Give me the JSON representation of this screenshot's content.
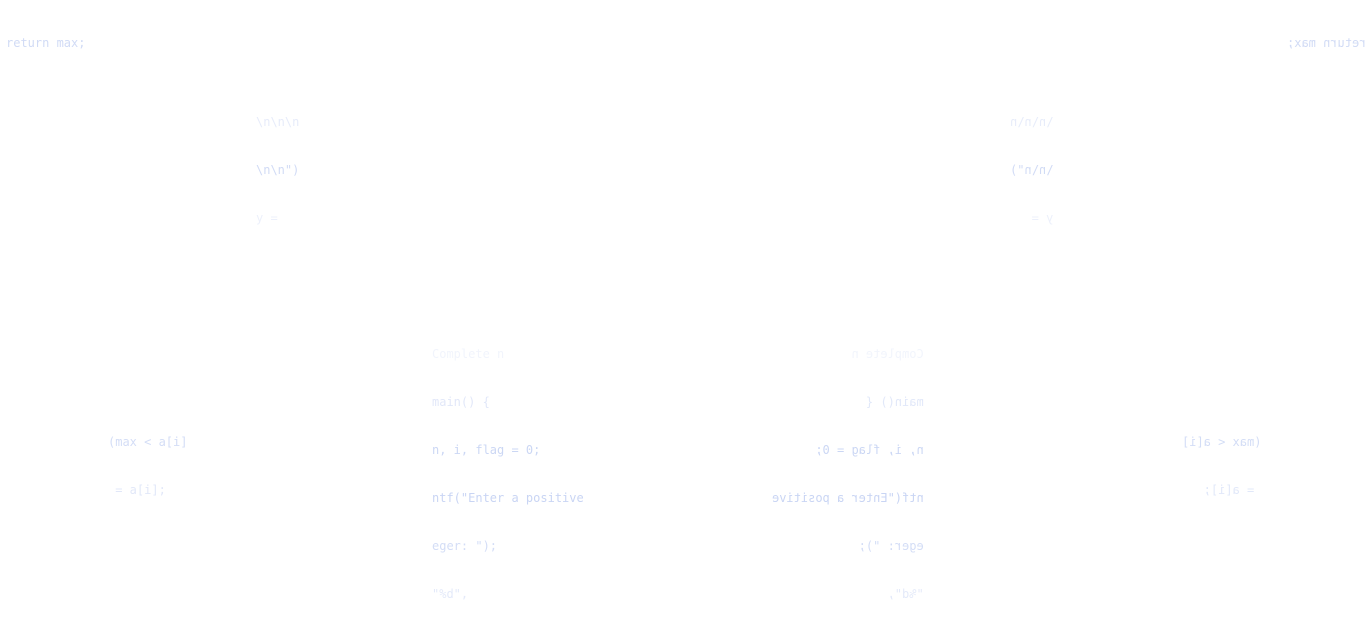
{
  "fragments": {
    "top_left": [
      "return max;"
    ],
    "top_right": [
      "return max;"
    ],
    "upper_left": [
      "\\n\\n\\n",
      "\\n\\n\")",
      "y = "
    ],
    "upper_right": [
      "\\n\\n\\n",
      "\\n\\n\")",
      "y = "
    ],
    "lower_left": [
      "Complete n",
      "main() {",
      "n, i, flag = 0;",
      "ntf(\"Enter a positive",
      "eger: \");",
      "\"%d\","
    ],
    "lower_right": [
      "Complete n",
      "main() {",
      "n, i, flag = 0;",
      "ntf(\"Enter a positive",
      "eger: \");",
      "\"%d\","
    ],
    "bottom_left": [
      "(max < a[i]",
      " = a[i];"
    ],
    "bottom_right": [
      "(max < a[i]",
      " = a[i];"
    ]
  }
}
